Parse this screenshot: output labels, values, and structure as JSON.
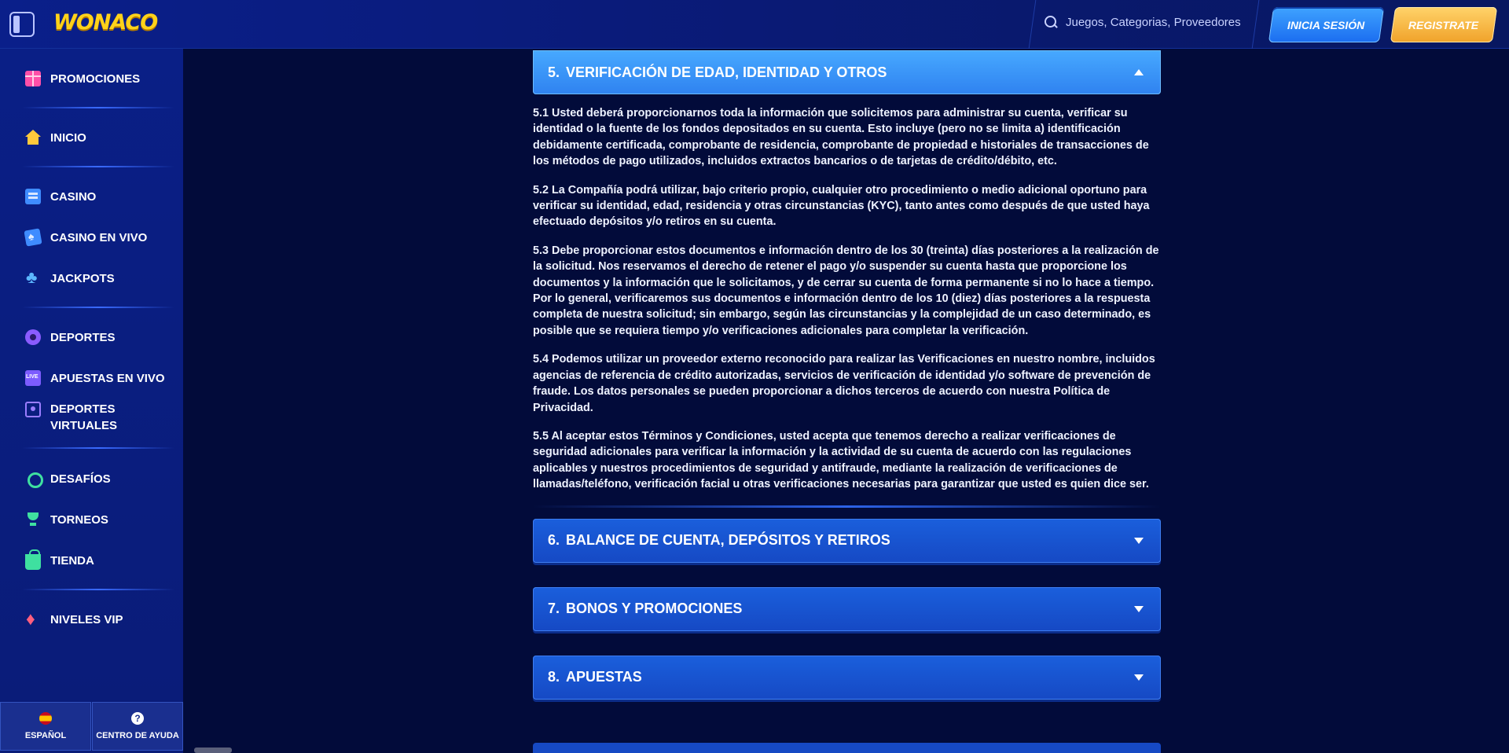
{
  "header": {
    "logo": "WONACO",
    "search_placeholder": "Juegos, Categorias, Proveedores",
    "login_label": "INICIA SESIÓN",
    "register_label": "REGISTRATE"
  },
  "sidebar": {
    "items": [
      {
        "label": "PROMOCIONES",
        "icon": "gift-icon"
      },
      {
        "label": "INICIO",
        "icon": "home-icon"
      },
      {
        "label": "CASINO",
        "icon": "slot-machine-icon"
      },
      {
        "label": "CASINO EN VIVO",
        "icon": "playing-card-icon"
      },
      {
        "label": "JACKPOTS",
        "icon": "clover-icon"
      },
      {
        "label": "DEPORTES",
        "icon": "soccer-ball-icon"
      },
      {
        "label": "APUESTAS EN VIVO",
        "icon": "live-badge-icon"
      },
      {
        "label": "DEPORTES VIRTUALES",
        "label_line1": "DEPORTES",
        "label_line2": "VIRTUALES",
        "icon": "virtual-sports-icon"
      },
      {
        "label": "DESAFÍOS",
        "icon": "medal-icon"
      },
      {
        "label": "TORNEOS",
        "icon": "trophy-icon"
      },
      {
        "label": "TIENDA",
        "icon": "shopping-bag-icon"
      },
      {
        "label": "NIVELES VIP",
        "icon": "gem-icon"
      }
    ],
    "footer": {
      "language_label": "ESPAÑOL",
      "help_label": "CENTRO DE AYUDA"
    }
  },
  "sections": [
    {
      "number": "5.",
      "title": "VERIFICACIÓN DE EDAD, IDENTIDAD Y OTROS",
      "expanded": true,
      "paragraphs": [
        "5.1 Usted deberá proporcionarnos toda la información que solicitemos para administrar su cuenta, verificar su identidad o la fuente de los fondos depositados en su cuenta. Esto incluye (pero no se limita a) identificación debidamente certificada, comprobante de residencia, comprobante de propiedad e historiales de transacciones de los métodos de pago utilizados, incluidos extractos bancarios o de tarjetas de crédito/débito, etc.",
        "5.2 La Compañía podrá utilizar, bajo criterio propio, cualquier otro procedimiento o medio adicional oportuno para verificar su identidad, edad, residencia y otras circunstancias (KYC), tanto antes como después de que usted haya efectuado depósitos y/o retiros en su cuenta.",
        "5.3 Debe proporcionar estos documentos e información dentro de los 30 (treinta) días posteriores a la realización de la solicitud. Nos reservamos el derecho de retener el pago y/o suspender su cuenta hasta que proporcione los documentos y la información que le solicitamos, y de cerrar su cuenta de forma permanente si no lo hace a tiempo. Por lo general, verificaremos sus documentos e información dentro de los 10 (diez) días posteriores a la respuesta completa de nuestra solicitud; sin embargo, según las circunstancias y la complejidad de un caso determinado, es posible que se requiera tiempo y/o verificaciones adicionales para completar la verificación.",
        "5.4 Podemos utilizar un proveedor externo reconocido para realizar las Verificaciones en nuestro nombre, incluidos agencias de referencia de crédito autorizadas, servicios de verificación de identidad y/o software de prevención de fraude. Los datos personales se pueden proporcionar a dichos terceros de acuerdo con nuestra Política de Privacidad.",
        "5.5 Al aceptar estos Términos y Condiciones, usted acepta que tenemos derecho a realizar verificaciones de seguridad adicionales para verificar la información y la actividad de su cuenta de acuerdo con las regulaciones aplicables y nuestros procedimientos de seguridad y antifraude, mediante la realización de verificaciones de llamadas/teléfono, verificación facial u otras verificaciones necesarias para garantizar que usted es quien dice ser."
      ]
    },
    {
      "number": "6.",
      "title": "BALANCE DE CUENTA, DEPÓSITOS Y RETIROS",
      "expanded": false
    },
    {
      "number": "7.",
      "title": "BONOS Y PROMOCIONES",
      "expanded": false
    },
    {
      "number": "8.",
      "title": "APUESTAS",
      "expanded": false
    }
  ],
  "colors": {
    "background": "#020b3a",
    "sidebar": "#0a1f86",
    "accent_blue": "#2f82f0",
    "accent_gold": "#ffd21a"
  }
}
